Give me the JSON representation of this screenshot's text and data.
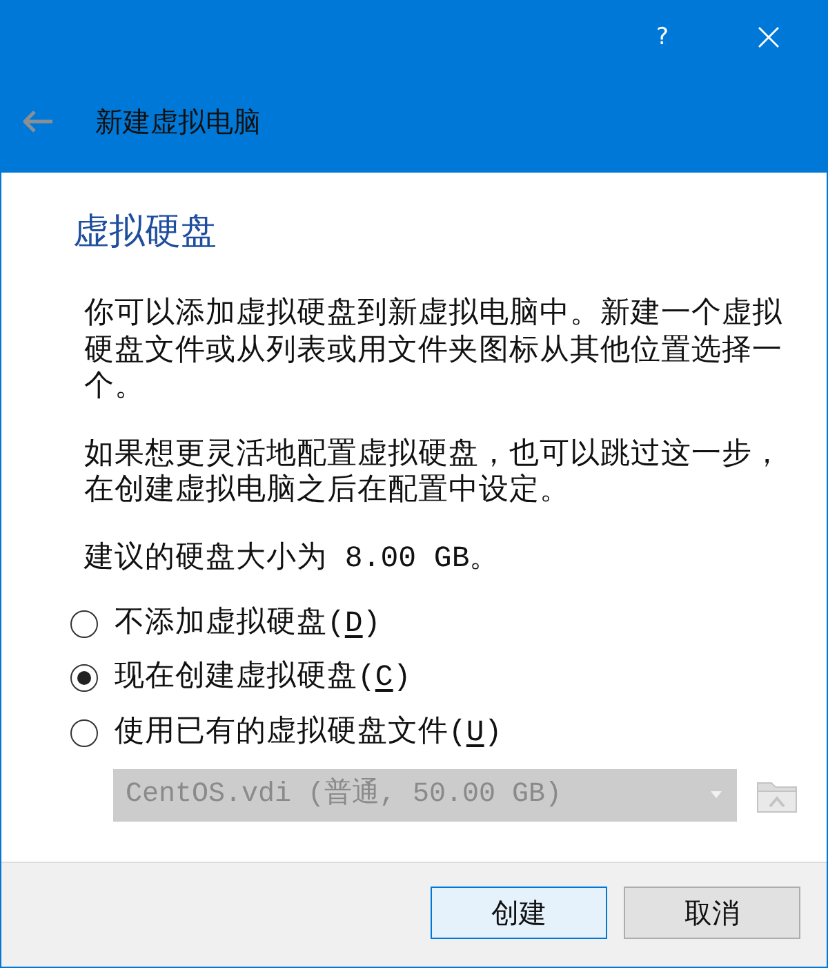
{
  "window": {
    "help": "?",
    "back": {
      "disabled": true
    },
    "title": "新建虚拟电脑"
  },
  "page": {
    "heading": "虚拟硬盘",
    "paragraphs": [
      "你可以添加虚拟硬盘到新虚拟电脑中。新建一个虚拟硬盘文件或从列表或用文件夹图标从其他位置选择一个。",
      "如果想更灵活地配置虚拟硬盘，也可以跳过这一步，在创建虚拟电脑之后在配置中设定。",
      "建议的硬盘大小为 8.00 GB。"
    ]
  },
  "options": [
    {
      "label": "不添加虚拟硬盘(",
      "mnemonic": "D",
      "label_end": ")",
      "selected": false
    },
    {
      "label": "现在创建虚拟硬盘(",
      "mnemonic": "C",
      "label_end": ")",
      "selected": true
    },
    {
      "label": "使用已有的虚拟硬盘文件(",
      "mnemonic": "U",
      "label_end": ")",
      "selected": false
    }
  ],
  "existing_disk": {
    "value": "CentOS.vdi (普通, 50.00 GB)",
    "disabled": true,
    "folder_disabled": true
  },
  "buttons": [
    {
      "label": "创建",
      "default": true
    },
    {
      "label": "取消",
      "default": false
    }
  ]
}
